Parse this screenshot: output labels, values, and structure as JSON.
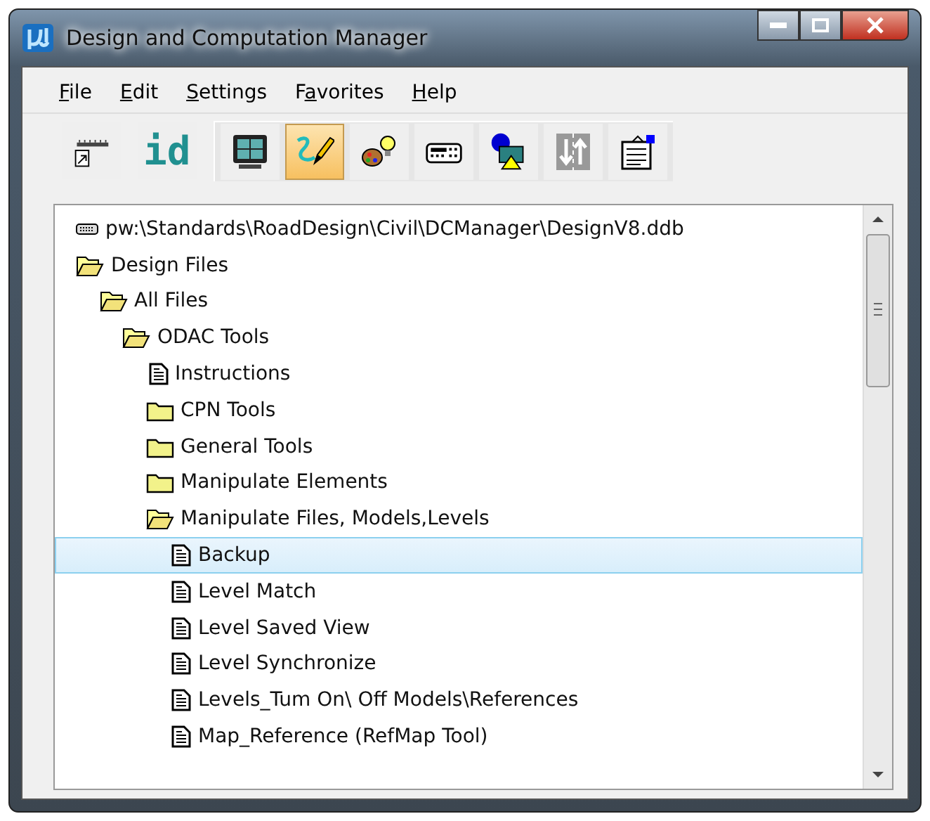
{
  "window": {
    "title": "Design and Computation Manager"
  },
  "menu": [
    {
      "key": "F",
      "rest": "ile"
    },
    {
      "key": "E",
      "rest": "dit"
    },
    {
      "key": "S",
      "rest": "ettings"
    },
    {
      "lead": "F",
      "key": "a",
      "rest": "vorites"
    },
    {
      "key": "H",
      "rest": "elp"
    }
  ],
  "toolbar": [
    {
      "kind": "ruler",
      "selected": false
    },
    {
      "kind": "text",
      "label": "id",
      "selected": false
    },
    {
      "kind": "monitor",
      "selected": false
    },
    {
      "kind": "pencil",
      "selected": true
    },
    {
      "kind": "palette",
      "selected": false
    },
    {
      "kind": "keypad",
      "selected": false
    },
    {
      "kind": "shapes",
      "selected": false
    },
    {
      "kind": "arrows",
      "selected": false
    },
    {
      "kind": "properties",
      "selected": false
    }
  ],
  "tree": [
    {
      "kind": "database",
      "label": "pw:\\Standards\\RoadDesign\\Civil\\DCManager\\DesignV8.ddb",
      "selected": false
    },
    {
      "kind": "folder",
      "label": "Design Files",
      "expanded": true,
      "selected": false,
      "children": [
        {
          "kind": "folder",
          "label": "All Files",
          "expanded": true,
          "selected": false,
          "children": [
            {
              "kind": "folder",
              "label": "ODAC Tools",
              "expanded": true,
              "selected": false,
              "children": [
                {
                  "kind": "file",
                  "label": "Instructions",
                  "selected": false
                },
                {
                  "kind": "folder",
                  "label": "CPN Tools",
                  "expanded": false,
                  "selected": false
                },
                {
                  "kind": "folder",
                  "label": "General Tools",
                  "expanded": false,
                  "selected": false
                },
                {
                  "kind": "folder",
                  "label": "Manipulate Elements",
                  "expanded": false,
                  "selected": false
                },
                {
                  "kind": "folder",
                  "label": "Manipulate Files, Models,Levels",
                  "expanded": true,
                  "selected": false,
                  "children": [
                    {
                      "kind": "file",
                      "label": "Backup",
                      "selected": true
                    },
                    {
                      "kind": "file",
                      "label": "Level Match",
                      "selected": false
                    },
                    {
                      "kind": "file",
                      "label": "Level Saved View",
                      "selected": false
                    },
                    {
                      "kind": "file",
                      "label": "Level Synchronize",
                      "selected": false
                    },
                    {
                      "kind": "file",
                      "label": "Levels_Tum On\\ Off Models\\References",
                      "selected": false
                    },
                    {
                      "kind": "file",
                      "label": "Map_Reference (RefMap Tool)",
                      "selected": false
                    }
                  ]
                }
              ]
            }
          ]
        }
      ]
    }
  ]
}
